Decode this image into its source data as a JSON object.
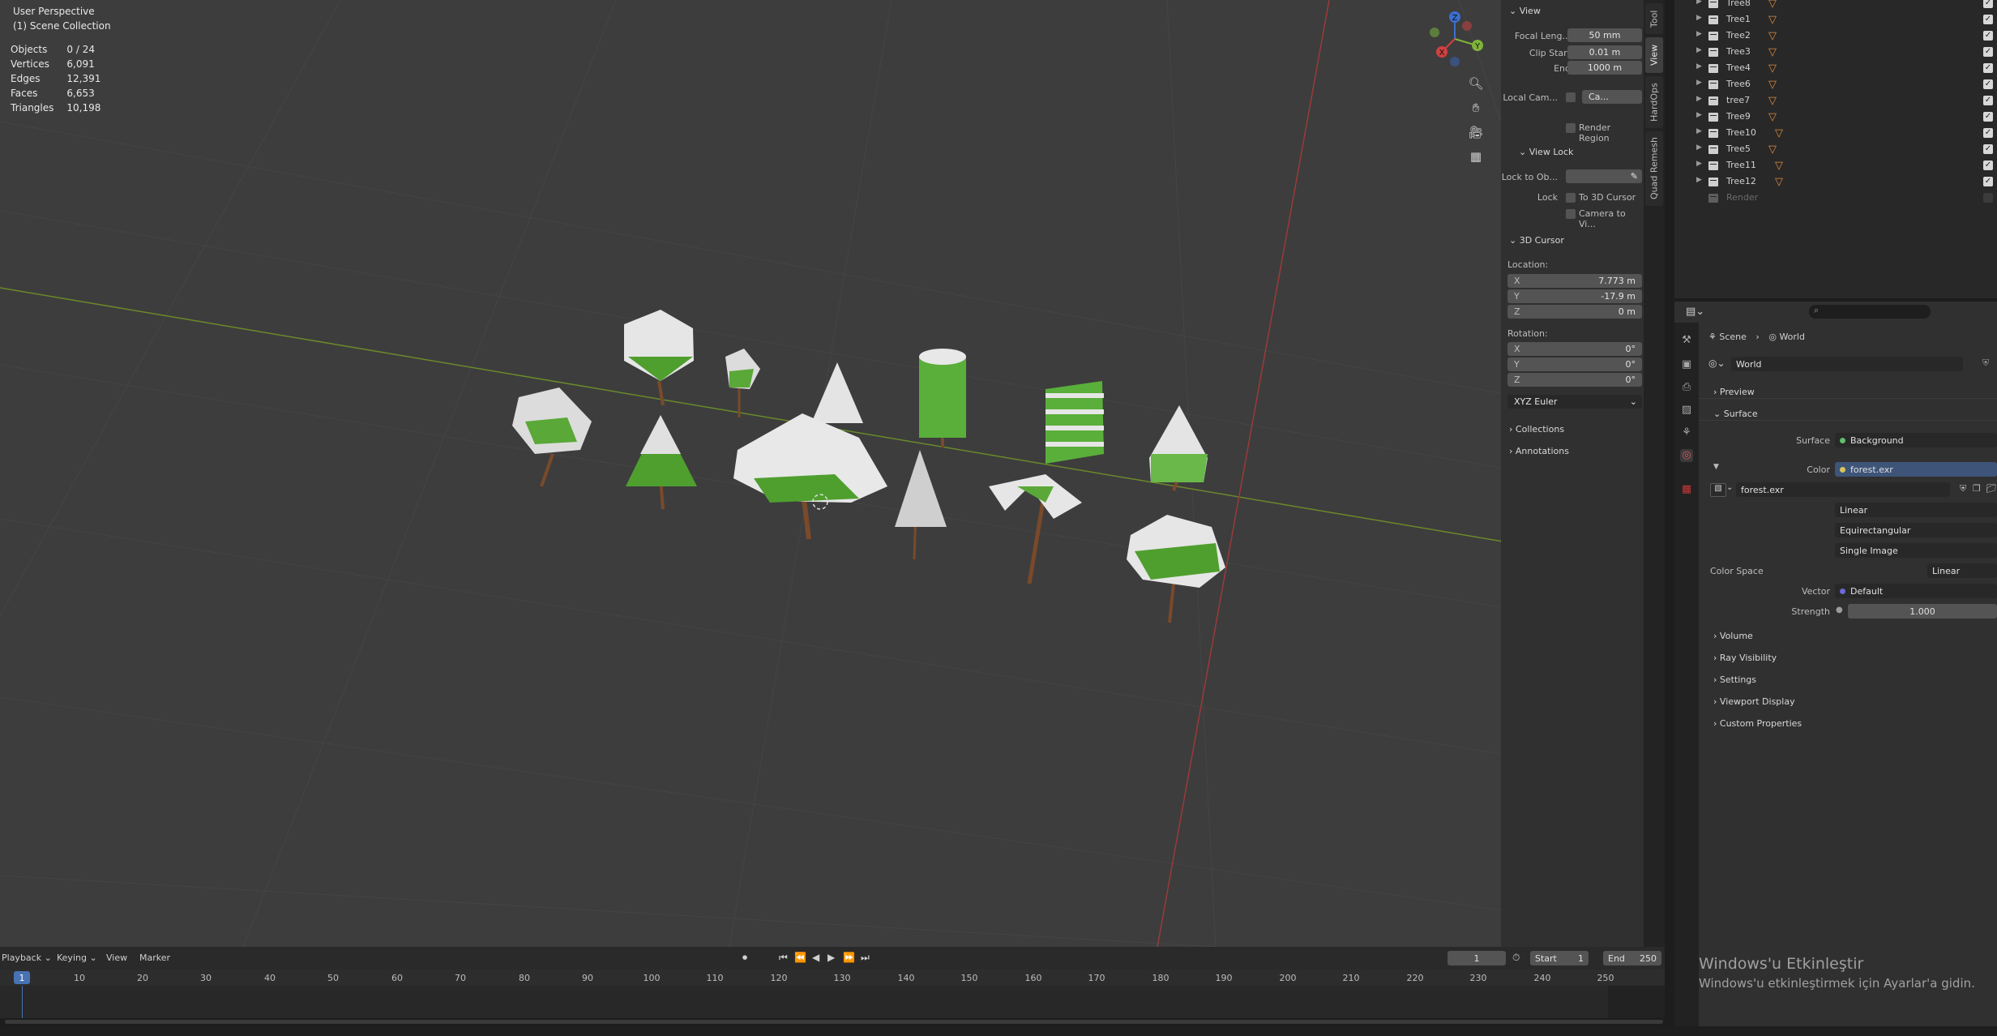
{
  "viewport": {
    "perspective": "User Perspective",
    "collection": "(1) Scene Collection",
    "stats": [
      {
        "label": "Objects",
        "value": "0 / 24"
      },
      {
        "label": "Vertices",
        "value": "6,091"
      },
      {
        "label": "Edges",
        "value": "12,391"
      },
      {
        "label": "Faces",
        "value": "6,653"
      },
      {
        "label": "Triangles",
        "value": "10,198"
      }
    ],
    "gizmo": {
      "x": "X",
      "y": "Y",
      "z": "Z"
    }
  },
  "npanel": {
    "view_header": "View",
    "focal_label": "Focal Leng...",
    "focal_value": "50 mm",
    "clip_start_label": "Clip Start",
    "clip_start_value": "0.01 m",
    "end_label": "End",
    "end_value": "1000 m",
    "local_cam_label": "Local Cam...",
    "local_cam_value": "Ca...",
    "render_region": "Render Region",
    "view_lock_header": "View Lock",
    "lock_to_label": "Lock to Ob...",
    "lock_label": "Lock",
    "to_cursor": "To 3D Cursor",
    "camera_to_view": "Camera to Vi...",
    "cursor_header": "3D Cursor",
    "location_label": "Location:",
    "loc": [
      {
        "axis": "X",
        "value": "7.773 m"
      },
      {
        "axis": "Y",
        "value": "-17.9 m"
      },
      {
        "axis": "Z",
        "value": "0 m"
      }
    ],
    "rotation_label": "Rotation:",
    "rot": [
      {
        "axis": "X",
        "value": "0°"
      },
      {
        "axis": "Y",
        "value": "0°"
      },
      {
        "axis": "Z",
        "value": "0°"
      }
    ],
    "euler": "XYZ Euler",
    "collections": "Collections",
    "annotations": "Annotations",
    "tabs": [
      "Tool",
      "View",
      "HardOps",
      "Quad Remesh"
    ]
  },
  "outliner": {
    "rows": [
      "Tree8",
      "Tree1",
      "Tree2",
      "Tree3",
      "Tree4",
      "Tree6",
      "tree7",
      "Tree9",
      "Tree10",
      "Tree5",
      "Tree11",
      "Tree12"
    ],
    "render_row": "Render"
  },
  "properties": {
    "breadcrumb_scene": "Scene",
    "breadcrumb_world": "World",
    "world_name": "World",
    "preview": "Preview",
    "surface": "Surface",
    "surface_label": "Surface",
    "surface_value": "Background",
    "color_label": "Color",
    "color_value": "forest.exr",
    "image_name": "forest.exr",
    "interp": "Linear",
    "projection": "Equirectangular",
    "source": "Single Image",
    "color_space_label": "Color Space",
    "color_space_value": "Linear",
    "vector_label": "Vector",
    "vector_value": "Default",
    "strength_label": "Strength",
    "strength_value": "1.000",
    "sections": [
      "Volume",
      "Ray Visibility",
      "Settings",
      "Viewport Display",
      "Custom Properties"
    ]
  },
  "timeline": {
    "menus": [
      "Playback",
      "Keying",
      "View",
      "Marker"
    ],
    "current_frame": "1",
    "start_label": "Start",
    "start_value": "1",
    "end_label": "End",
    "end_value": "250",
    "ticks": [
      "1",
      "10",
      "20",
      "30",
      "40",
      "50",
      "60",
      "70",
      "80",
      "90",
      "100",
      "110",
      "120",
      "130",
      "140",
      "150",
      "160",
      "170",
      "180",
      "190",
      "200",
      "210",
      "220",
      "230",
      "240",
      "250"
    ]
  },
  "watermark": {
    "line1": "Windows'u Etkinleştir",
    "line2": "Windows'u etkinleştirmek için Ayarlar'a gidin."
  }
}
